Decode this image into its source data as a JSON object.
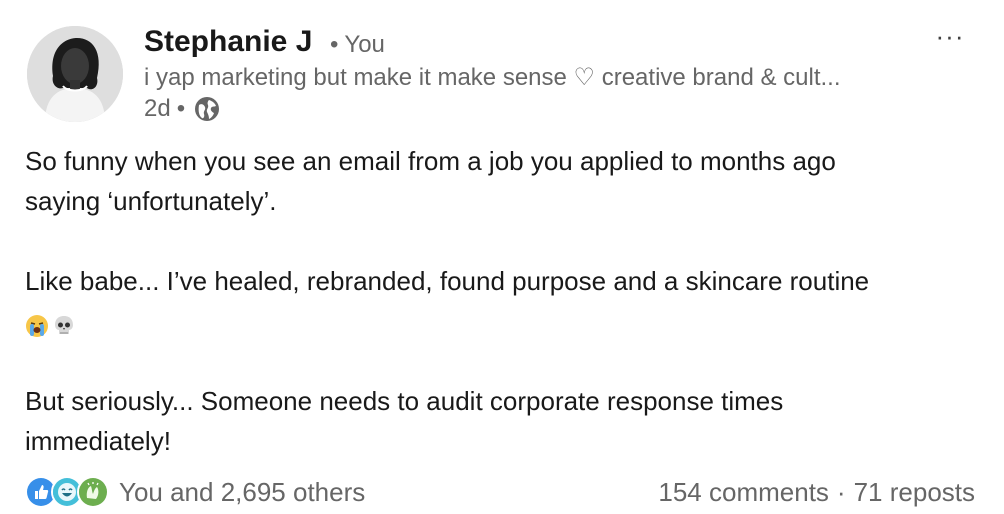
{
  "author": {
    "name": "Stephanie J",
    "you_label": "You",
    "separator": "•",
    "headline": "i yap marketing but make it make sense ♡ creative brand & cult...",
    "time_ago": "2d",
    "meta_separator": "•",
    "visibility_icon": "globe-icon"
  },
  "menu": {
    "more_label": "···"
  },
  "post": {
    "line1": "So funny when you see an email from a job you applied to months ago",
    "line2": "saying ‘unfortunately’.",
    "line3": "Like babe... I’ve healed, rebranded, found purpose and a skincare routine",
    "emojis": [
      "loudly-crying-face-emoji",
      "skull-emoji"
    ],
    "line4": "But seriously... Someone needs to audit corporate response times",
    "line5": "immediately!"
  },
  "social": {
    "reaction_icons": [
      "like-icon",
      "funny-icon",
      "celebrate-icon"
    ],
    "reactions_text": "You and 2,695 others",
    "comments_text": "154 comments",
    "dot": "·",
    "reposts_text": "71 reposts"
  },
  "colors": {
    "text_primary": "#191919",
    "text_secondary": "#666666",
    "like_blue": "#378fe9",
    "funny_teal": "#44bfd9",
    "celebrate_green": "#6dae4f"
  }
}
